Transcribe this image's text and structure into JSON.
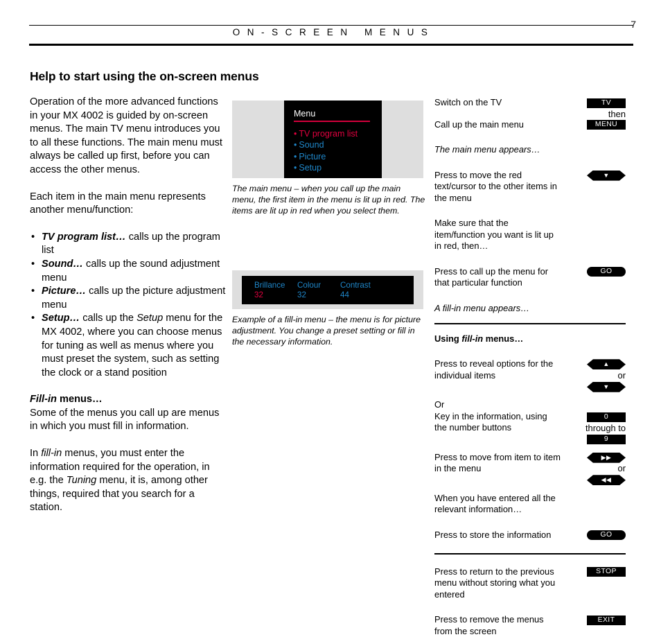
{
  "header": {
    "title": "O N - S C R E E N   M E N U S",
    "page_number": "7"
  },
  "page_title": "Help to start using the on-screen menus",
  "left_column": {
    "paragraph_1": "Operation of the more advanced functions in your MX 4002 is guided by on-screen menus. The main TV menu introduces you to all these functions. The main menu must always be called up first, before you can access the other menus.",
    "paragraph_2": "Each item in the main menu represents another menu/function:",
    "bullets": [
      {
        "term": "TV program list…",
        "rest": " calls up the program list"
      },
      {
        "term": "Sound…",
        "rest": " calls up the sound adjustment menu"
      },
      {
        "term": "Picture…",
        "rest": " calls up the picture adjustment menu"
      },
      {
        "term": "Setup…",
        "rest_a": " calls up the ",
        "rest_it": "Setup",
        "rest_b": " menu for the MX 4002, where you can choose menus for tuning as well as menus where you must preset the system, such as setting the clock or a stand position"
      }
    ],
    "fillin_heading_it": "Fill-in",
    "fillin_heading_rest": " menus…",
    "paragraph_3": "Some of the menus you call up are menus in which you must fill in information.",
    "paragraph_4_a": "In ",
    "paragraph_4_it1": "fill-in",
    "paragraph_4_b": " menus, you must enter the information required for the operation, in e.g. the ",
    "paragraph_4_it2": "Tuning",
    "paragraph_4_c": " menu, it is, among other things, required that you search for a station."
  },
  "center_column": {
    "main_menu_screen": {
      "title": "Menu",
      "items": [
        {
          "bullet": "•",
          "label": "TV program list",
          "color": "#e2003f"
        },
        {
          "bullet": "•",
          "label": "Sound",
          "color": "#1f86c8"
        },
        {
          "bullet": "•",
          "label": "Picture",
          "color": "#1f86c8"
        },
        {
          "bullet": "•",
          "label": "Setup",
          "color": "#1f86c8"
        }
      ]
    },
    "caption_1": "The main menu – when you call up the main menu, the first item in the menu is lit up in red. The items are lit up in red when you select them.",
    "fillin_screen": {
      "columns": [
        {
          "label": "Brillance",
          "value": "32",
          "value_color": "#e2003f"
        },
        {
          "label": "Colour",
          "value": "32",
          "value_color": "#1f86c8"
        },
        {
          "label": "Contrast",
          "value": "44",
          "value_color": "#1f86c8"
        }
      ]
    },
    "caption_2": "Example of a fill-in menu – the menu is for picture adjustment. You change a preset setting or fill in the necessary information."
  },
  "right_column": {
    "steps": [
      {
        "text": "Switch on the TV",
        "key": "TV",
        "key_style": "rect"
      },
      {
        "connector": "then"
      },
      {
        "text": "Call up the main menu",
        "key": "MENU",
        "key_style": "rect"
      },
      {
        "note": "The main menu appears…"
      },
      {
        "text": "Press to move the red text/cursor to the other items in the menu",
        "key": "▼",
        "key_style": "hex"
      },
      {
        "text": "Make sure that the item/function you want is lit up in red, then…"
      },
      {
        "text": "Press to call up the menu for that particular function",
        "key": "GO",
        "key_style": "pill"
      },
      {
        "note": "A fill-in menu appears…"
      }
    ],
    "section_heading_a": "Using ",
    "section_heading_it": "fill-in",
    "section_heading_b": " menus…",
    "steps2": [
      {
        "text": "Press to reveal options for the individual items",
        "key_up": "▲",
        "connector": "or",
        "key_down": "▼",
        "key_style": "hex"
      },
      {
        "text_a": "Or",
        "text_b": "Key in the information, using the number buttons",
        "key_up": "0",
        "connector": "through to",
        "key_down": "9",
        "key_style": "rect"
      },
      {
        "text": "Press to move from item to item in the menu",
        "key_up": "▶▶",
        "connector": "or",
        "key_down": "◀◀",
        "key_style": "hex"
      },
      {
        "note": "When you have entered all the relevant information…"
      },
      {
        "text": "Press to store the information",
        "key": "GO",
        "key_style": "pill"
      }
    ],
    "steps3": [
      {
        "text": "Press to return to the previous menu without storing what you entered",
        "key": "STOP",
        "key_style": "rect"
      },
      {
        "text": "Press to remove the menus from the screen",
        "key": "EXIT",
        "key_style": "rect"
      }
    ]
  },
  "colors": {
    "menu_red": "#e2003f",
    "menu_blue": "#1f86c8",
    "screen_black": "#000000",
    "frame_gray": "#dedede"
  }
}
